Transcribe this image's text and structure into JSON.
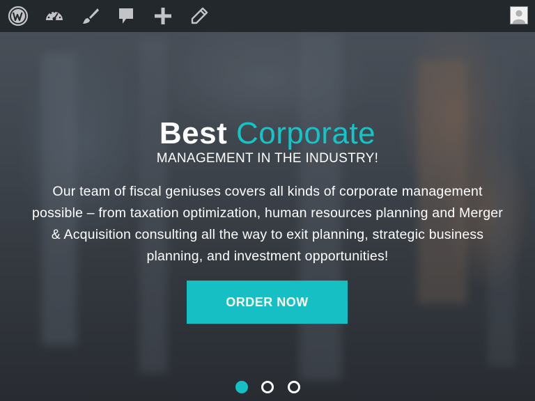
{
  "admin_bar": {
    "icons": [
      "wordpress-logo-icon",
      "dashboard-icon",
      "brush-icon",
      "comment-icon",
      "plus-icon",
      "pencil-icon"
    ],
    "avatar": "user-avatar"
  },
  "hero": {
    "headline_bold": "Best",
    "headline_accent": "Corporate",
    "subhead": "MANAGEMENT IN THE INDUSTRY!",
    "body": "Our team of fiscal geniuses covers all kinds of corporate management possible – from taxation optimization, human resources planning and Merger & Acquisition consulting all the way to exit planning, strategic business planning, and investment opportunities!",
    "cta_label": "ORDER NOW"
  },
  "slider": {
    "dots": 3,
    "active_index": 0
  },
  "colors": {
    "accent": "#15bfc3",
    "admin_bar": "#23282d"
  }
}
